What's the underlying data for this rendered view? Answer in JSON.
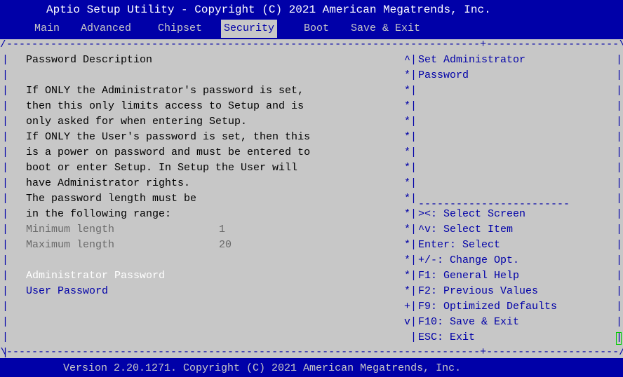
{
  "header": {
    "title": "Aptio Setup Utility - Copyright (C) 2021 American Megatrends, Inc."
  },
  "menu": {
    "tabs": [
      {
        "label": "Main"
      },
      {
        "label": "Advanced"
      },
      {
        "label": "Chipset"
      },
      {
        "label": "Security",
        "active": true
      },
      {
        "label": "Boot"
      },
      {
        "label": "Save & Exit"
      }
    ]
  },
  "left": {
    "heading": "Password Description",
    "paragraph": [
      "If ONLY the Administrator's password is set,",
      "then this only limits access to Setup and is",
      "only asked for when entering Setup.",
      "If ONLY the User's password is set, then this",
      "is a power on password and must be entered to",
      "boot or enter Setup. In Setup the User will",
      "have Administrator rights.",
      "The password length must be",
      "in the following range:"
    ],
    "min_label": "Minimum length",
    "min_value": "1",
    "max_label": "Maximum length",
    "max_value": "20",
    "admin_password": "Administrator Password",
    "user_password": "User Password"
  },
  "help": {
    "lines": [
      "Set Administrator",
      "Password"
    ]
  },
  "scrollbar": {
    "top": "^",
    "track": "*",
    "plus": "+",
    "bottom": "v"
  },
  "keys": [
    "><: Select Screen",
    "^v: Select Item",
    "Enter: Select",
    "+/-: Change Opt.",
    "F1: General Help",
    "F2: Previous Values",
    "F9: Optimized Defaults",
    "F10: Save & Exit",
    "ESC: Exit"
  ],
  "footer": {
    "text": "Version 2.20.1271. Copyright (C) 2021 American Megatrends, Inc."
  },
  "colors": {
    "bios_blue": "#0000a8",
    "bios_gray": "#c7c7c7",
    "highlight_white": "#ffffff"
  }
}
